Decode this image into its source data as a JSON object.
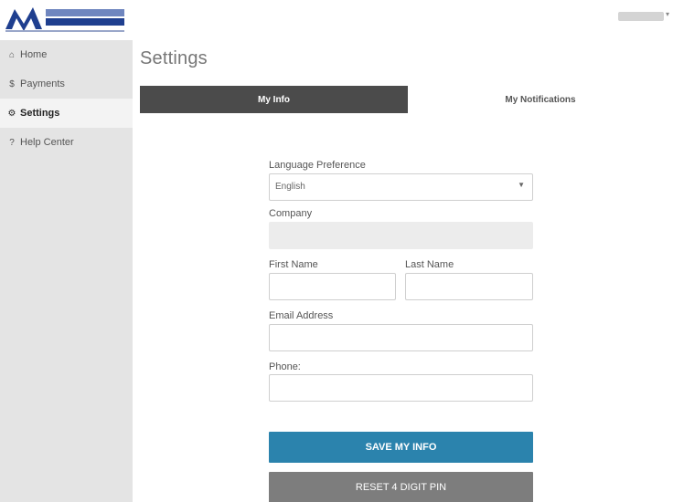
{
  "brand": {
    "logo_name": "MidAmerica National Bank",
    "logo_color": "#1f3f8f"
  },
  "nav": [
    {
      "icon": "home-icon",
      "glyph": "⌂",
      "label": "Home",
      "active": false
    },
    {
      "icon": "dollar-icon",
      "glyph": "$",
      "label": "Payments",
      "active": false
    },
    {
      "icon": "gear-icon",
      "glyph": "⚙",
      "label": "Settings",
      "active": true
    },
    {
      "icon": "help-icon",
      "glyph": "?",
      "label": "Help Center",
      "active": false
    }
  ],
  "page": {
    "title": "Settings"
  },
  "tabs": [
    {
      "label": "My Info",
      "active": true
    },
    {
      "label": "My Notifications",
      "active": false
    }
  ],
  "form": {
    "language_label": "Language Preference",
    "language_value": "English",
    "company_label": "Company",
    "company_value": "",
    "first_name_label": "First Name",
    "first_name_value": "",
    "last_name_label": "Last Name",
    "last_name_value": "",
    "email_label": "Email Address",
    "email_value": "",
    "phone_label": "Phone:",
    "phone_value": ""
  },
  "buttons": {
    "save_label": "SAVE MY INFO",
    "reset_label": "RESET 4 DIGIT PIN"
  },
  "colors": {
    "primary": "#2b83ad",
    "tab_active": "#4b4b4b",
    "secondary_button": "#7d7d7d",
    "sidebar_bg": "#e4e4e4"
  }
}
